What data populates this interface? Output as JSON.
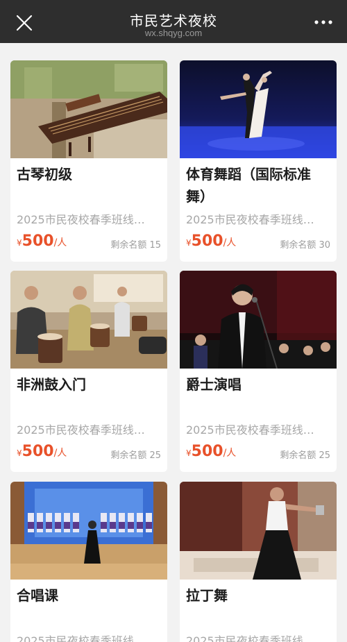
{
  "header": {
    "title": "市民艺术夜校",
    "url": "wx.shqyg.com"
  },
  "courses": [
    {
      "name": "古琴初级",
      "subtitle": "2025市民夜校春季班线…",
      "currency": "¥",
      "price": "500",
      "unit": "/人",
      "quota": "剩余名额 15"
    },
    {
      "name": "体育舞蹈（国际标准舞）",
      "subtitle": "2025市民夜校春季班线…",
      "currency": "¥",
      "price": "500",
      "unit": "/人",
      "quota": "剩余名额 30"
    },
    {
      "name": "非洲鼓入门",
      "subtitle": "2025市民夜校春季班线…",
      "currency": "¥",
      "price": "500",
      "unit": "/人",
      "quota": "剩余名额 25"
    },
    {
      "name": "爵士演唱",
      "subtitle": "2025市民夜校春季班线…",
      "currency": "¥",
      "price": "500",
      "unit": "/人",
      "quota": "剩余名额 25"
    },
    {
      "name": "合唱课",
      "subtitle": "2025市民夜校春季班线"
    },
    {
      "name": "拉丁舞",
      "subtitle": "2025市民夜校春季班线"
    }
  ],
  "colors": {
    "header_bg": "#2e2e2e",
    "page_bg": "#f2f2f2",
    "price": "#e8512a"
  }
}
